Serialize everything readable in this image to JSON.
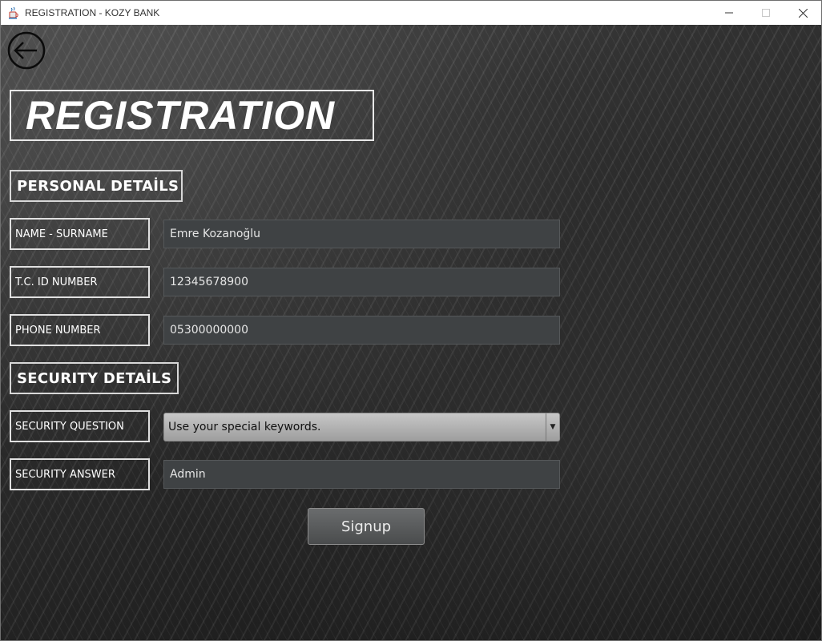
{
  "window": {
    "title": "REGISTRATION - KOZY BANK",
    "icon": "java-cup-icon"
  },
  "page": {
    "heading": "REGISTRATION",
    "back_icon": "arrow-left-circle-icon"
  },
  "sections": {
    "personal": "PERSONAL DETAİLS",
    "security": "SECURITY DETAİLS"
  },
  "fields": {
    "name": {
      "label": "NAME - SURNAME",
      "value": "Emre Kozanoğlu"
    },
    "tc_id": {
      "label": "T.C. ID NUMBER",
      "value": "12345678900"
    },
    "phone": {
      "label": "PHONE NUMBER",
      "value": "05300000000"
    },
    "security_question": {
      "label": "SECURITY QUESTION",
      "selected": "Use your special keywords."
    },
    "security_answer": {
      "label": "SECURITY ANSWER",
      "value": "Admin"
    }
  },
  "buttons": {
    "signup": "Signup"
  },
  "colors": {
    "field_bg": "#3f4244",
    "label_border": "#e0e0e0",
    "button_bg": "#5a5c5d"
  }
}
